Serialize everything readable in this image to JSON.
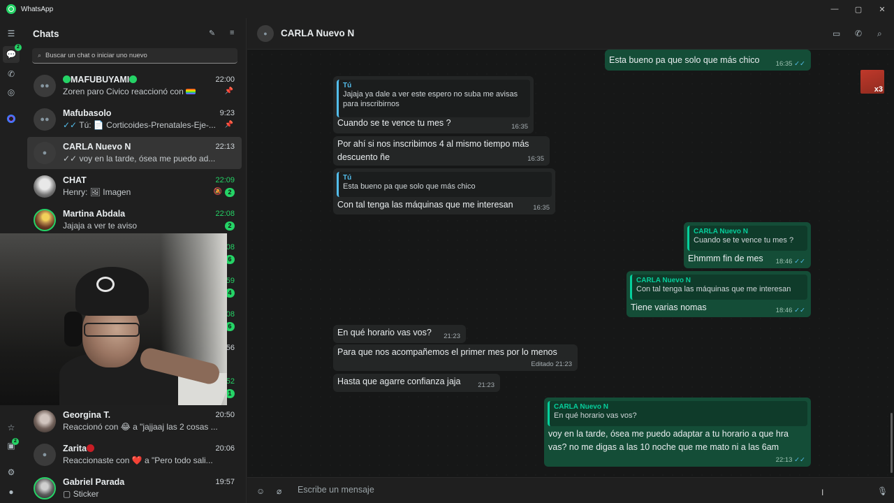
{
  "window": {
    "title": "WhatsApp",
    "controls": [
      "—",
      "▢",
      "✕"
    ]
  },
  "rail": {
    "chats_badge": "2",
    "status_badge": "2"
  },
  "chatlist": {
    "title": "Chats",
    "search_placeholder": "Buscar un chat o iniciar uno nuevo",
    "chats": [
      {
        "name": "MAFUBUYAMI",
        "time": "22:00",
        "preview": "Zoren paro Civico reaccionó con",
        "pinned": true
      },
      {
        "name": "Mafubasolo",
        "time": "9:23",
        "preview": "Tú: 📄 Corticoides-Prenatales-Eje-...",
        "pinned": true
      },
      {
        "name": "CARLA Nuevo N",
        "time": "22:13",
        "preview": "voy en la tarde, ósea me puedo ad...",
        "selected": true
      },
      {
        "name": "CHAT",
        "time": "22:09",
        "preview": "Henry: 🖼 Imagen",
        "badge": "2",
        "muted": true
      },
      {
        "name": "Martina Abdala",
        "time": "22:08",
        "preview": "Jajaja a ver te aviso",
        "badge": "2"
      },
      {
        "name": "Georgina T.",
        "time": "20:50",
        "preview": "Reaccionó con 😂 a \"jajjaaj las 2 cosas ..."
      },
      {
        "name": "Zarita",
        "time": "20:06",
        "preview": "Reaccionaste con ❤️ a \"Pero todo sali..."
      },
      {
        "name": "Gabriel Parada",
        "time": "19:57",
        "preview": "Sticker"
      }
    ],
    "hidden_rows": [
      {
        "time": "08",
        "badge": "6"
      },
      {
        "time": "59",
        "badge": "4"
      },
      {
        "time": "08",
        "badge": "6"
      },
      {
        "time": "56",
        "badge": ""
      },
      {
        "time": "52",
        "badge": "1"
      }
    ]
  },
  "conversation": {
    "contact": "CARLA Nuevo N",
    "messages": [
      {
        "dir": "out",
        "text": "Esta bueno pa que solo que más chico",
        "time": "16:35"
      },
      {
        "dir": "in",
        "quote_author": "Tú",
        "quote_line1": "Jajaja ya dale a ver este espero no suba me avisas",
        "quote_line2": "para inscribirnos",
        "text": "Cuando se te vence tu mes ?",
        "time": "16:35"
      },
      {
        "dir": "in",
        "text_line1": "Por ahí si nos inscribimos 4 al mismo tiempo más",
        "text_line2": "descuento ñe",
        "time": "16:35"
      },
      {
        "dir": "in",
        "quote_author": "Tú",
        "quote_line1": "Esta bueno pa que solo que más chico",
        "text": "Con tal tenga las máquinas que me interesan",
        "time": "16:35"
      },
      {
        "dir": "out",
        "quote_author": "CARLA Nuevo N",
        "quote_line1": "Cuando se te vence tu mes ?",
        "text": "Ehmmm fin de mes",
        "time": "18:46"
      },
      {
        "dir": "out",
        "quote_author": "CARLA Nuevo N",
        "quote_line1": "Con tal tenga las máquinas que me interesan",
        "text": "Tiene varias nomas",
        "time": "18:46"
      },
      {
        "dir": "in",
        "text": "En qué horario vas vos?",
        "time": "21:23"
      },
      {
        "dir": "in",
        "text": "Para que nos acompañemos el primer mes por lo menos",
        "time": "Editado 21:23"
      },
      {
        "dir": "in",
        "text": "Hasta que agarre confianza jaja",
        "time": "21:23"
      },
      {
        "dir": "out",
        "quote_author": "CARLA Nuevo N",
        "quote_line1": "En qué horario vas vos?",
        "text_line1": "voy en la tarde, ósea me puedo adaptar a tu horario a que hra",
        "text_line2": "vas? no me digas a las 10 noche que me mato ni a las 6am",
        "time": "22:13"
      }
    ],
    "sticker_label": "x3"
  },
  "composer": {
    "placeholder": "Escribe un mensaje"
  },
  "colors": {
    "accent": "#25d366",
    "outgoing_bubble": "#144d37",
    "incoming_bubble": "#242626",
    "read_ticks": "#53bdeb"
  }
}
